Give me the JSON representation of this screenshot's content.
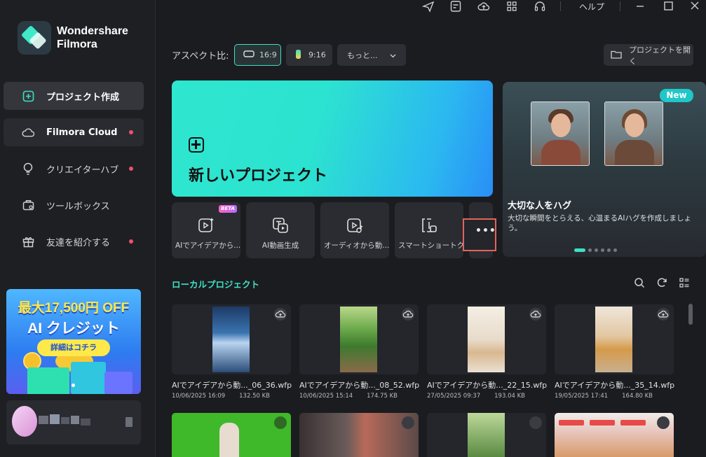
{
  "app": {
    "logo_line1": "Wondershare",
    "logo_line2": "Filmora",
    "help_label": "ヘルプ"
  },
  "sidebar": {
    "items": [
      {
        "label": "プロジェクト作成",
        "icon": "plus-square-icon"
      },
      {
        "label": "Filmora Cloud",
        "icon": "cloud-icon"
      },
      {
        "label": "クリエイターハブ",
        "icon": "bulb-icon"
      },
      {
        "label": "ツールボックス",
        "icon": "toolbox-icon"
      },
      {
        "label": "友達を紹介する",
        "icon": "gift-icon"
      }
    ]
  },
  "promo": {
    "line1": "最大17,500円 OFF",
    "line2": "AI クレジット",
    "button": "詳細はコチラ"
  },
  "aspect": {
    "label": "アスペクト比:",
    "options": [
      "16:9",
      "9:16"
    ],
    "more_label": "もっと...",
    "open_project": "プロジェクトを開く"
  },
  "new_project": {
    "title": "新しいプロジェクト"
  },
  "tools": [
    {
      "label": "AIでアイデアから...",
      "badge": "BETA"
    },
    {
      "label": "AI動画生成"
    },
    {
      "label": "オーディオから動..."
    },
    {
      "label": "スマートショートク..."
    }
  ],
  "feature": {
    "badge": "New",
    "title": "大切な人をハグ",
    "desc": "大切な瞬間をとらえる、心温まるAIハグを作成しましょう。"
  },
  "local": {
    "title": "ローカルプロジェクト",
    "projects": [
      {
        "name": "AIでアイデアから動..._06_36.wfp",
        "date": "10/06/2025 16:09",
        "size": "132.50 KB"
      },
      {
        "name": "AIでアイデアから動..._08_52.wfp",
        "date": "10/06/2025 15:14",
        "size": "174.75 KB"
      },
      {
        "name": "AIでアイデアから動..._22_15.wfp",
        "date": "27/05/2025 09:37",
        "size": "193.04 KB"
      },
      {
        "name": "AIでアイデアから動..._35_14.wfp",
        "date": "19/05/2025 17:41",
        "size": "164.80 KB"
      }
    ]
  }
}
